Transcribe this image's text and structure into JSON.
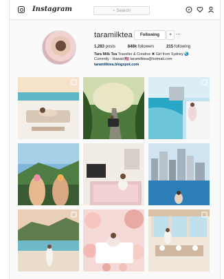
{
  "topbar": {
    "brand": "Instagram",
    "search_placeholder": "Search",
    "icons": [
      "instagram-glyph-icon",
      "compass-icon",
      "heart-icon",
      "person-icon"
    ]
  },
  "profile": {
    "username": "taramilktea",
    "follow_label": "Following",
    "plus_label": "+",
    "more_label": "...",
    "posts_count": "1,283",
    "posts_label": "posts",
    "followers_count": "848k",
    "followers_label": "followers",
    "following_count": "215",
    "following_label": "following",
    "bio_name": "Tara Milk Tea",
    "bio_line1": "Traveller & Creative ✖ Girl from Sydney 🌏",
    "bio_line2": "Currently - Hawaii 🇺🇸 taramilktea@hotmail.com",
    "bio_link": "taramilktea.blogspot.com"
  },
  "colors": {
    "accent": "#003569",
    "border": "#dbdbdb",
    "background": "#fafafa"
  }
}
